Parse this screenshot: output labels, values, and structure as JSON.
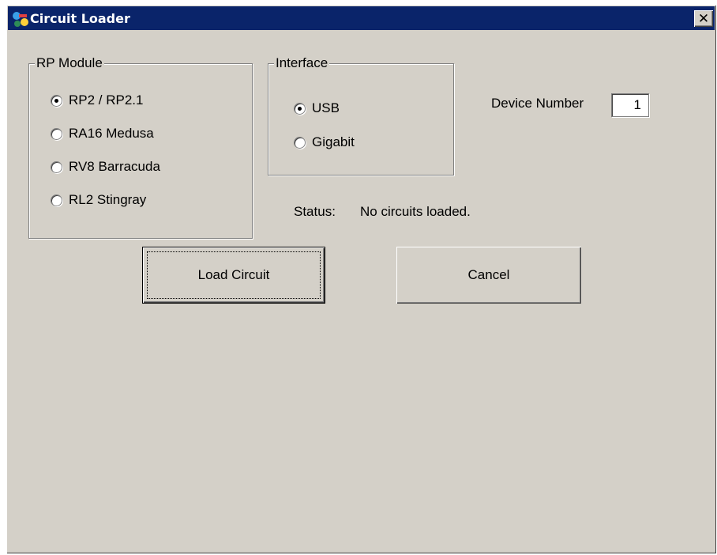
{
  "window": {
    "title": "Circuit Loader",
    "close_glyph": "✕",
    "app_icon": "circuit-loader-icon"
  },
  "rp_module": {
    "legend": "RP Module",
    "options": [
      {
        "label": "RP2 / RP2.1",
        "checked": true
      },
      {
        "label": "RA16 Medusa",
        "checked": false
      },
      {
        "label": "RV8 Barracuda",
        "checked": false
      },
      {
        "label": "RL2 Stingray",
        "checked": false
      }
    ]
  },
  "interface": {
    "legend": "Interface",
    "options": [
      {
        "label": "USB",
        "checked": true
      },
      {
        "label": "Gigabit",
        "checked": false
      }
    ]
  },
  "device": {
    "label": "Device Number",
    "value": "1"
  },
  "status": {
    "label": "Status:",
    "text": "No circuits loaded."
  },
  "buttons": {
    "load": "Load Circuit",
    "cancel": "Cancel"
  },
  "colors": {
    "titlebar": "#0a246a",
    "face": "#d4d0c8"
  }
}
